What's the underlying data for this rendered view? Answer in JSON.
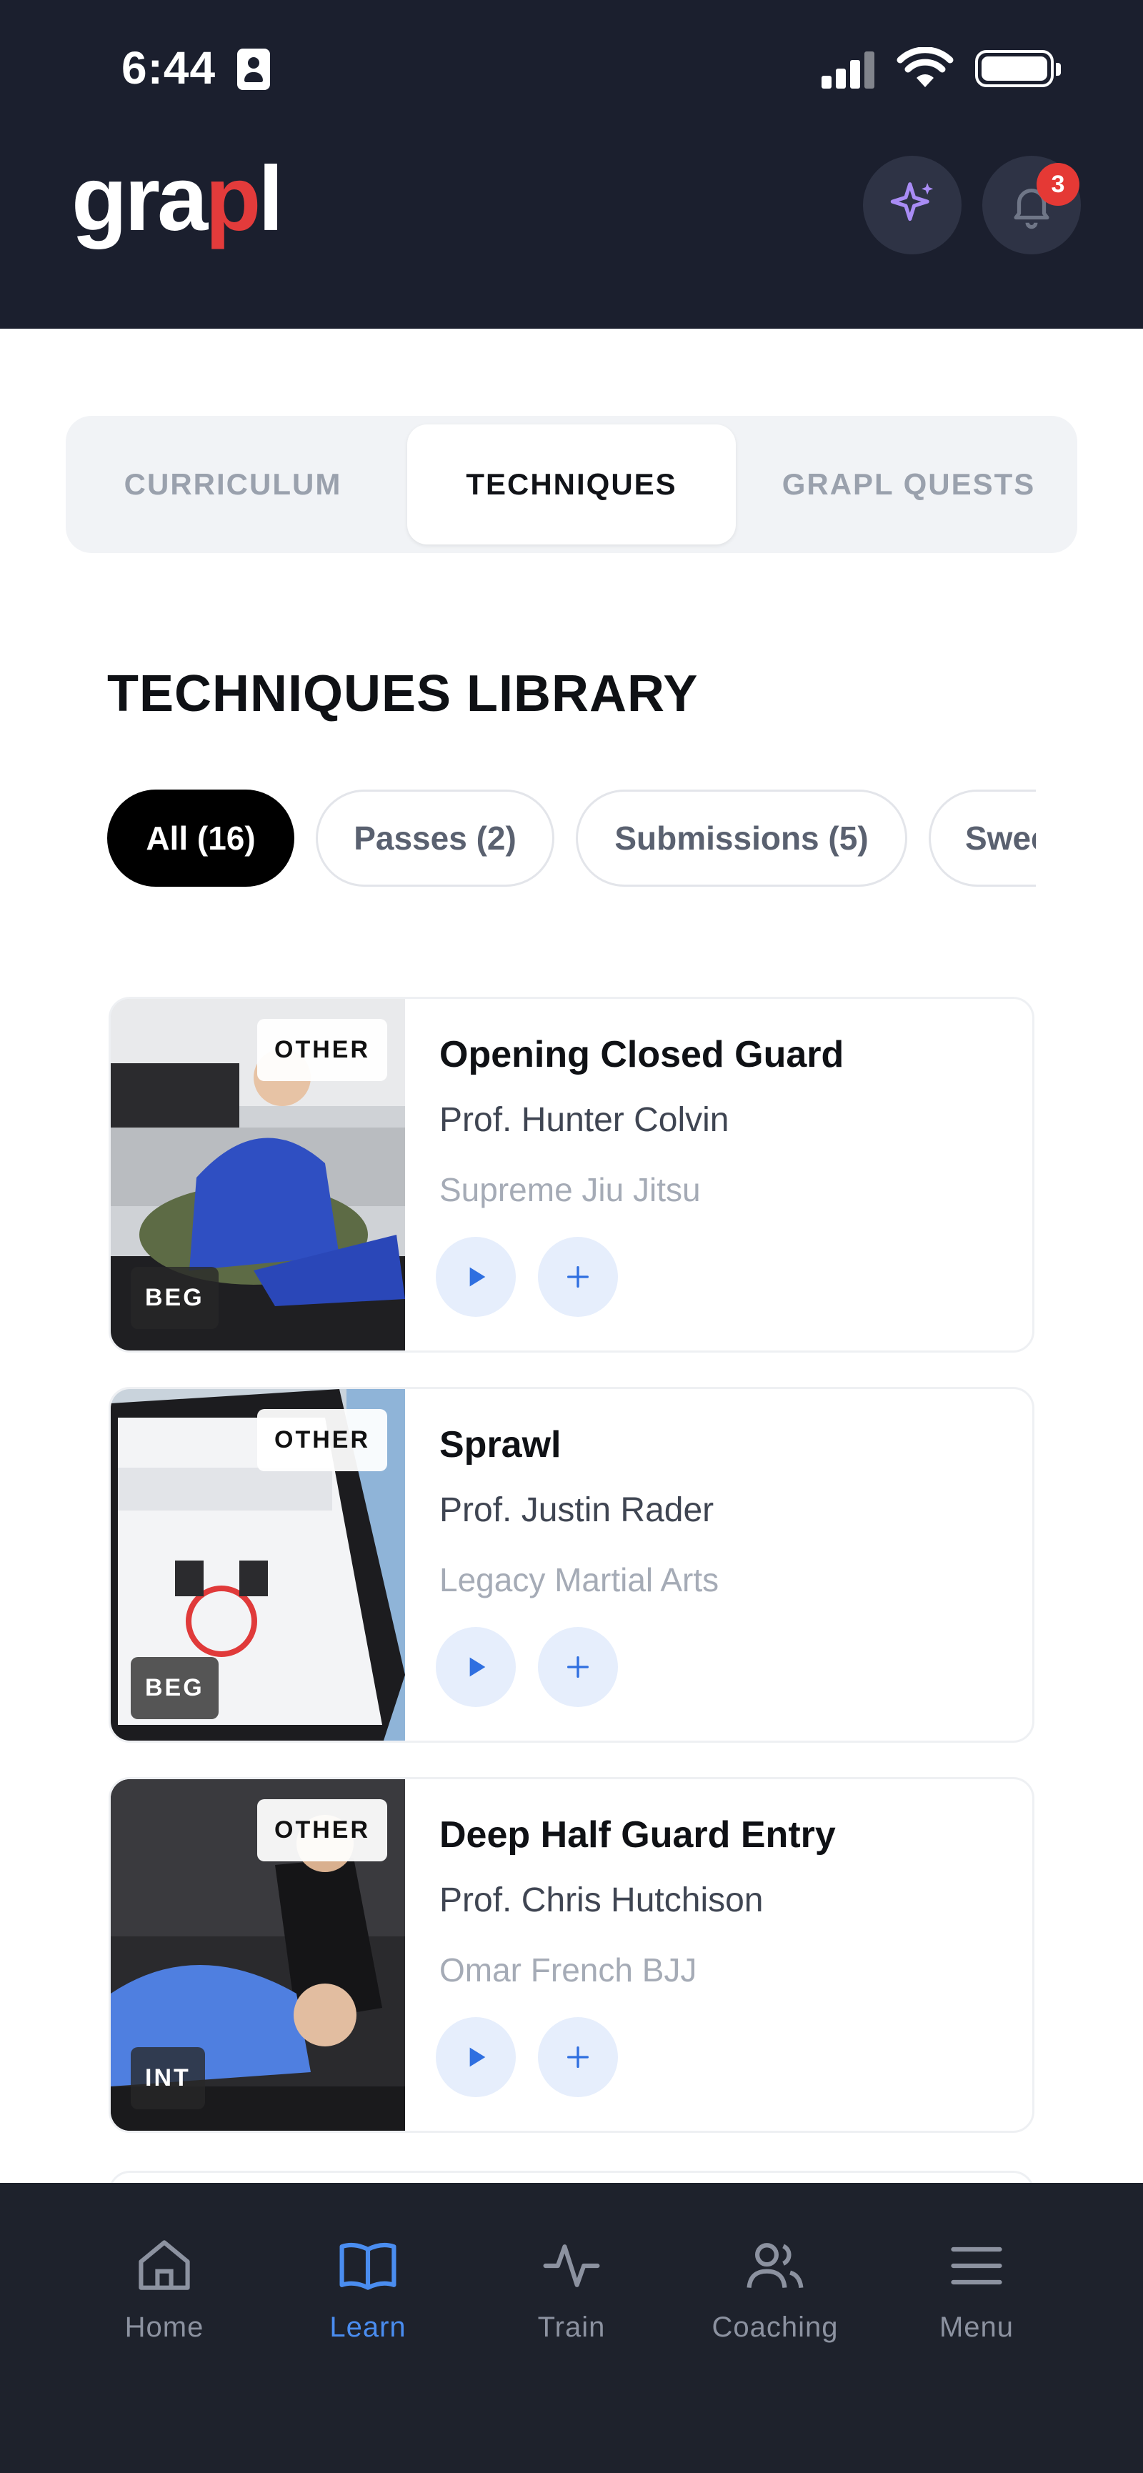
{
  "status_bar": {
    "time": "6:44"
  },
  "header": {
    "logo_text_1": "gra",
    "logo_text_2": "p",
    "logo_text_3": "l",
    "notification_count": "3"
  },
  "tabs": [
    {
      "label": "CURRICULUM"
    },
    {
      "label": "TECHNIQUES"
    },
    {
      "label": "GRAPL QUESTS"
    }
  ],
  "section_title": "TECHNIQUES LIBRARY",
  "filters": [
    {
      "label": "All (16)"
    },
    {
      "label": "Passes (2)"
    },
    {
      "label": "Submissions (5)"
    },
    {
      "label": "Swee"
    }
  ],
  "techniques": [
    {
      "title": "Opening Closed Guard",
      "coach": "Prof. Hunter Colvin",
      "gym": "Supreme Jiu Jitsu",
      "category": "OTHER",
      "level": "BEG"
    },
    {
      "title": "Sprawl",
      "coach": "Prof. Justin Rader",
      "gym": "Legacy Martial Arts",
      "category": "OTHER",
      "level": "BEG"
    },
    {
      "title": "Deep Half Guard Entry",
      "coach": "Prof. Chris Hutchison",
      "gym": "Omar French BJJ",
      "category": "OTHER",
      "level": "INT"
    }
  ],
  "bottom_nav": [
    {
      "label": "Home"
    },
    {
      "label": "Learn"
    },
    {
      "label": "Train"
    },
    {
      "label": "Coaching"
    },
    {
      "label": "Menu"
    }
  ],
  "colors": {
    "accent": "#4a8df0",
    "header_bg": "#1b1f2e",
    "brand_red": "#e33b3b",
    "sparkle": "#a98cf5"
  }
}
